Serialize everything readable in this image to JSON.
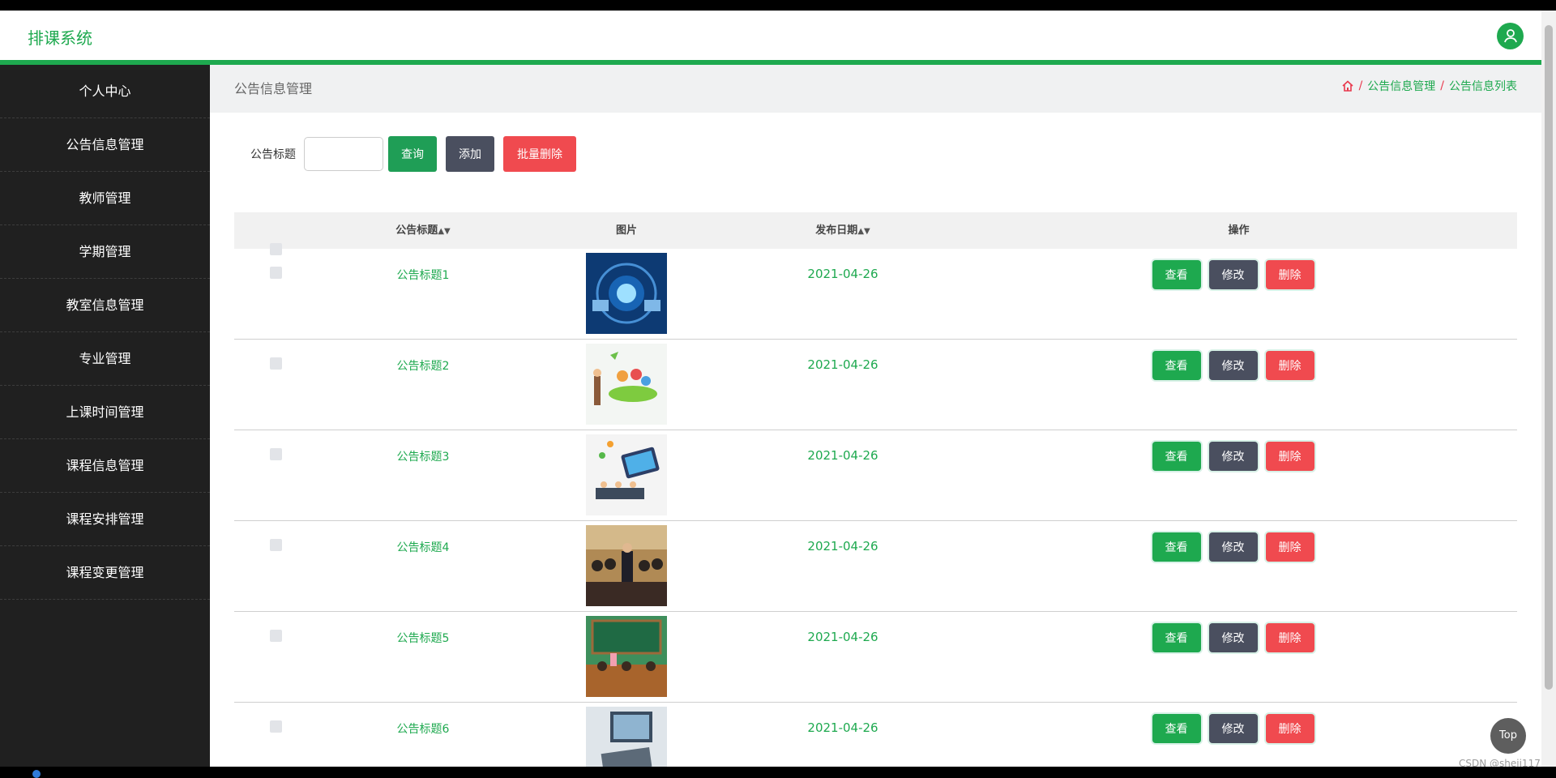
{
  "header": {
    "title": "排课系统",
    "avatar_icon": "user-icon",
    "accent": "#1ea94f"
  },
  "sidebar": {
    "items": [
      {
        "label": "个人中心"
      },
      {
        "label": "公告信息管理"
      },
      {
        "label": "教师管理"
      },
      {
        "label": "学期管理"
      },
      {
        "label": "教室信息管理"
      },
      {
        "label": "专业管理"
      },
      {
        "label": "上课时间管理"
      },
      {
        "label": "课程信息管理"
      },
      {
        "label": "课程安排管理"
      },
      {
        "label": "课程变更管理"
      }
    ]
  },
  "crumbbar": {
    "title": "公告信息管理",
    "crumbs": [
      "公告信息管理",
      "公告信息列表"
    ],
    "home_icon": "home-icon"
  },
  "search": {
    "label": "公告标题",
    "value": "",
    "query_label": "查询",
    "add_label": "添加",
    "batch_delete_label": "批量删除"
  },
  "table": {
    "columns": {
      "title": "公告标题",
      "image": "图片",
      "date": "发布日期",
      "ops": "操作"
    },
    "rows": [
      {
        "title": "公告标题1",
        "date": "2021-04-26"
      },
      {
        "title": "公告标题2",
        "date": "2021-04-26"
      },
      {
        "title": "公告标题3",
        "date": "2021-04-26"
      },
      {
        "title": "公告标题4",
        "date": "2021-04-26"
      },
      {
        "title": "公告标题5",
        "date": "2021-04-26"
      },
      {
        "title": "公告标题6",
        "date": "2021-04-26"
      }
    ],
    "view_label": "查看",
    "edit_label": "修改",
    "delete_label": "删除"
  },
  "top_button": "Top",
  "watermark": "CSDN @sheji117"
}
